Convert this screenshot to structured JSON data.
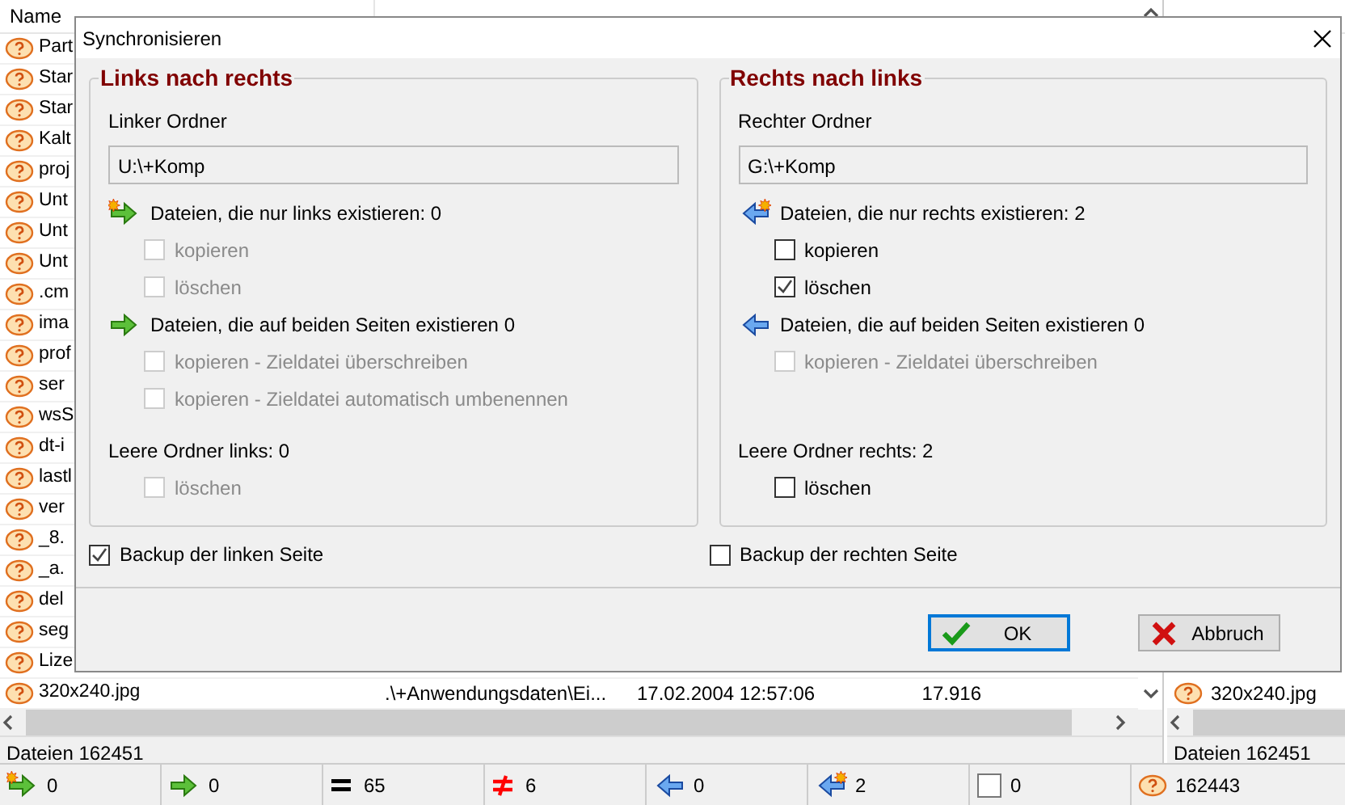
{
  "left_panel": {
    "columns": [
      "Name"
    ],
    "rows": [
      {
        "name": "Part"
      },
      {
        "name": "Star"
      },
      {
        "name": "Star"
      },
      {
        "name": "Kalt"
      },
      {
        "name": "proj"
      },
      {
        "name": "Unt"
      },
      {
        "name": "Unt"
      },
      {
        "name": "Unt"
      },
      {
        "name": ".cm"
      },
      {
        "name": "ima"
      },
      {
        "name": "prof"
      },
      {
        "name": "ser"
      },
      {
        "name": "wsS"
      },
      {
        "name": "dt-i"
      },
      {
        "name": "lastl"
      },
      {
        "name": "ver"
      },
      {
        "name": "_8."
      },
      {
        "name": "_a."
      },
      {
        "name": "del"
      },
      {
        "name": "seg"
      },
      {
        "name": "Lize"
      },
      {
        "name": "320x240.jpg",
        "path": ".\\+Anwendungsdaten\\Ei...",
        "changed": "17.02.2004 12:57:06",
        "size": "17.916"
      }
    ],
    "footer": "Dateien 162451"
  },
  "right_panel": {
    "rows": [
      {
        "name": "320x240.jpg"
      }
    ],
    "footer": "Dateien 162451"
  },
  "status_bar": [
    {
      "kind": "new-right",
      "count": "0"
    },
    {
      "kind": "right",
      "count": "0"
    },
    {
      "kind": "equal",
      "count": "65"
    },
    {
      "kind": "unequal",
      "count": "6"
    },
    {
      "kind": "left",
      "count": "0"
    },
    {
      "kind": "new-left",
      "count": "2"
    },
    {
      "kind": "blank",
      "count": "0"
    },
    {
      "kind": "unknown",
      "count": "162443"
    }
  ],
  "dialog": {
    "title": "Synchronisieren",
    "groups": [
      {
        "title": "Links nach rechts",
        "folder_label": "Linker Ordner",
        "folder_value": "U:\\+Komp",
        "items": [
          {
            "kind": "new-right",
            "text": "Dateien, die nur links existieren: 0"
          },
          {
            "kind": "checkbox",
            "label": "kopieren",
            "checked": false,
            "disabled": true
          },
          {
            "kind": "checkbox",
            "label": "löschen",
            "checked": false,
            "disabled": true
          },
          {
            "kind": "right",
            "text": "Dateien, die auf beiden Seiten existieren 0"
          },
          {
            "kind": "checkbox",
            "label": "kopieren - Zieldatei überschreiben",
            "checked": false,
            "disabled": true
          },
          {
            "kind": "checkbox",
            "label": "kopieren - Zieldatei automatisch umbenennen",
            "checked": false,
            "disabled": true
          }
        ],
        "empty_label": "Leere Ordner links: 0",
        "empty_option": {
          "label": "löschen",
          "checked": false,
          "disabled": true
        },
        "backup": {
          "label": "Backup der linken Seite",
          "checked": true
        }
      },
      {
        "title": "Rechts nach links",
        "folder_label": "Rechter Ordner",
        "folder_value": "G:\\+Komp",
        "items": [
          {
            "kind": "new-left",
            "text": "Dateien, die nur rechts existieren: 2"
          },
          {
            "kind": "checkbox",
            "label": "kopieren",
            "checked": false,
            "disabled": false
          },
          {
            "kind": "checkbox",
            "label": "löschen",
            "checked": true,
            "disabled": false
          },
          {
            "kind": "left",
            "text": "Dateien, die auf beiden Seiten existieren 0"
          },
          {
            "kind": "checkbox",
            "label": "kopieren - Zieldatei überschreiben",
            "checked": false,
            "disabled": true
          }
        ],
        "empty_label": "Leere Ordner rechts: 2",
        "empty_option": {
          "label": "löschen",
          "checked": false,
          "disabled": false
        },
        "backup": {
          "label": "Backup der rechten Seite",
          "checked": false
        }
      }
    ],
    "buttons": [
      {
        "kind": "ok",
        "label": "OK",
        "focused": true
      },
      {
        "kind": "cancel",
        "label": "Abbruch",
        "focused": false
      }
    ]
  }
}
